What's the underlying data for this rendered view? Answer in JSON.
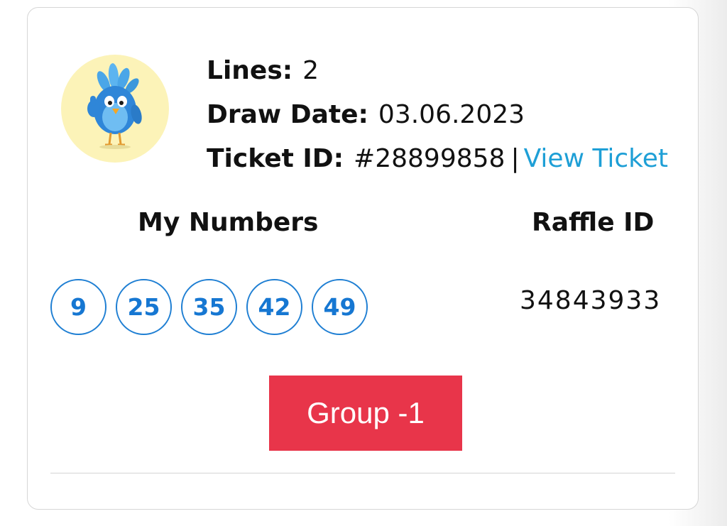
{
  "ticket": {
    "lines_label": "Lines:",
    "lines_value": "2",
    "draw_date_label": "Draw Date:",
    "draw_date_value": "03.06.2023",
    "ticket_id_label": "Ticket ID:",
    "ticket_id_value": "#28899858",
    "separator": "|",
    "view_ticket_link": "View Ticket"
  },
  "my_numbers": {
    "heading": "My Numbers",
    "numbers": [
      "9",
      "25",
      "35",
      "42",
      "49"
    ]
  },
  "raffle": {
    "heading": "Raffle ID",
    "value": "34843933"
  },
  "group_button": {
    "label": "Group -1"
  },
  "avatar": {
    "icon": "bird-mascot-thumbs-up-icon"
  },
  "colors": {
    "accent_blue": "#1677d2",
    "link_blue": "#1e9fd6",
    "button_red": "#e8354a",
    "avatar_bg": "#fcf3b8"
  }
}
